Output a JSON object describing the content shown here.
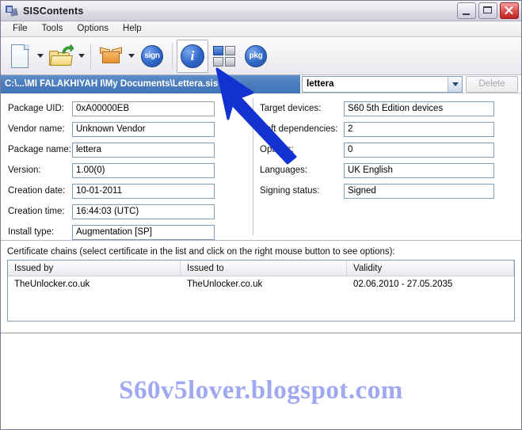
{
  "window": {
    "title": "SISContents",
    "icon": "app-icon",
    "controls": {
      "minimize": "minimize",
      "maximize": "maximize",
      "close": "close"
    }
  },
  "menu": {
    "items": [
      {
        "label": "File"
      },
      {
        "label": "Tools"
      },
      {
        "label": "Options"
      },
      {
        "label": "Help"
      }
    ]
  },
  "toolbar": {
    "buttons": [
      {
        "name": "new-document-icon",
        "caret": true
      },
      {
        "name": "open-folder-icon",
        "caret": true
      },
      {
        "name": "package-box-icon",
        "caret": true
      },
      {
        "name": "sign-icon",
        "label": "sign",
        "caret": false
      },
      {
        "name": "info-icon",
        "label": "i",
        "caret": false,
        "selected": true
      },
      {
        "name": "four-squares-icon",
        "caret": false
      },
      {
        "name": "pkg-icon",
        "label": "pkg",
        "caret": false
      }
    ]
  },
  "pathbar": {
    "path": "C:\\...\\MI FALAKHIYAH I\\My Documents\\Lettera.sis",
    "combo_value": "lettera",
    "delete_label": "Delete",
    "delete_enabled": false
  },
  "form": {
    "left": [
      {
        "label": "Package UID:",
        "value": "0xA00000EB",
        "border": "gray"
      },
      {
        "label": "Vendor name:",
        "value": "Unknown Vendor",
        "border": "blue"
      },
      {
        "label": "Package name:",
        "value": "lettera",
        "border": "blue"
      },
      {
        "label": "Version:",
        "value": "1.00(0)",
        "border": "blue"
      },
      {
        "label": "Creation date:",
        "value": "10-01-2011",
        "border": "blue"
      },
      {
        "label": "Creation time:",
        "value": "16:44:03 (UTC)",
        "border": "blue"
      },
      {
        "label": "Install type:",
        "value": "Augmentation [SP]",
        "border": "blue"
      }
    ],
    "right": [
      {
        "label": "Target devices:",
        "value": "S60 5th Edition devices"
      },
      {
        "label": "Soft dependencies:",
        "value": "2"
      },
      {
        "label": "Options:",
        "value": "0"
      },
      {
        "label": "Languages:",
        "value": "UK English"
      },
      {
        "label": "Signing status:",
        "value": "Signed"
      }
    ]
  },
  "certificates": {
    "caption": "Certificate chains (select certificate in the list and click on the right mouse button to see options):",
    "columns": [
      "Issued by",
      "Issued to",
      "Validity"
    ],
    "rows": [
      {
        "issued_by": "TheUnlocker.co.uk",
        "issued_to": "TheUnlocker.co.uk",
        "validity": "02.06.2010 - 27.05.2035"
      }
    ]
  },
  "watermark": {
    "text": "S60v5lover.blogspot.com",
    "color": "#9fa8f0"
  },
  "annotation": {
    "arrow": "blue-arrow-pointing-up-left",
    "color": "#1432d2"
  },
  "colors": {
    "path_bar": "#4a7cbd",
    "accent_blue": "#2f67c8",
    "field_border": "#7f9db9"
  }
}
